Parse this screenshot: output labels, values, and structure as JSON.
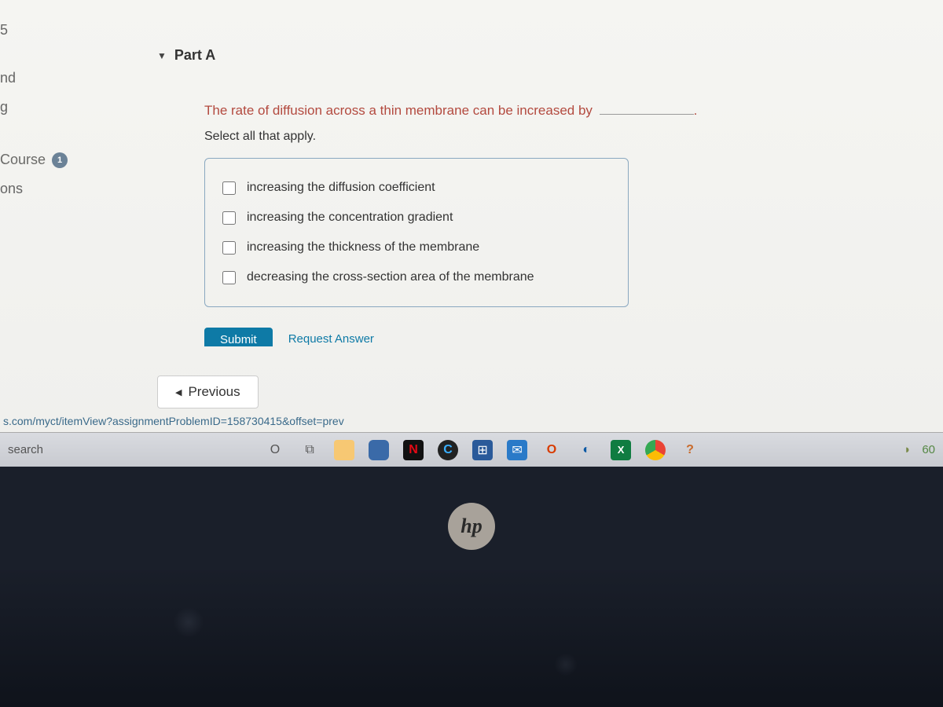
{
  "sidebar": {
    "items": [
      "5",
      "nd",
      "g"
    ],
    "course": {
      "label": "Course",
      "badge": "1"
    },
    "ons": "ons"
  },
  "part": {
    "label": "Part A"
  },
  "question": {
    "prompt": "The rate of diffusion across a thin membrane can be increased by",
    "instruction": "Select all that apply.",
    "options": [
      "increasing the diffusion coefficient",
      "increasing the concentration gradient",
      "increasing the thickness of the membrane",
      "decreasing the cross-section area of the membrane"
    ]
  },
  "actions": {
    "submit": "Submit",
    "request": "Request Answer"
  },
  "nav": {
    "previous": "Previous",
    "url": "s.com/myct/itemView?assignmentProblemID=158730415&offset=prev"
  },
  "taskbar": {
    "search": "search",
    "time_partial": "60"
  },
  "logo": "hp"
}
